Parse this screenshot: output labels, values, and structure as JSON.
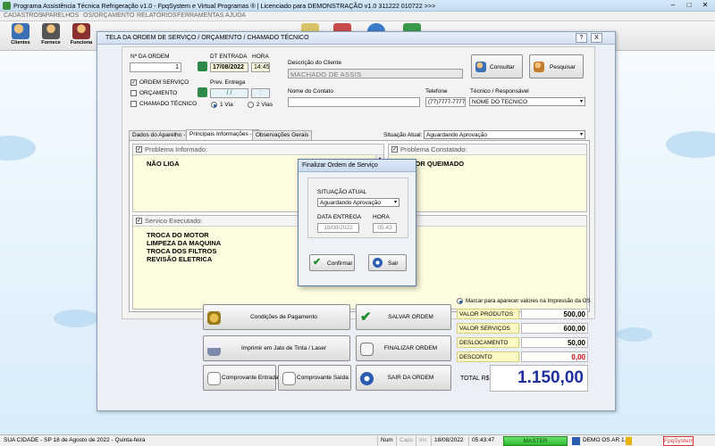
{
  "app": {
    "title": "Programa Assistência Técnica Refrigeração v1.0 - FpqSystem e Virtual Programas ® | Licenciado para  DEMONSTRAÇÃO v1.0 311222 010722 >>>"
  },
  "menu": [
    "CADASTROS",
    "APARELHOS",
    "OS/ORÇAMENTO",
    "RELATÓRIOS",
    "FERRAMENTAS",
    "AJUDA"
  ],
  "toolbar": {
    "clientes": "Clientes",
    "fornece": "Fornece",
    "funciona": "Funciona"
  },
  "window": {
    "title": "TELA DA ORDEM DE SERVIÇO / ORÇAMENTO / CHAMADO TÉCNICO",
    "help": "?",
    "close": "X"
  },
  "form": {
    "ordem_label": "Nº DA ORDEM",
    "ordem_value": "1",
    "dt_entrada_label": "DT ENTRADA",
    "dt_entrada_value": "17/08/2022",
    "hora_label": "HORA",
    "hora_value": "14:45",
    "prev_entrega_label": "Prev. Entrega",
    "prev_entrega_value": "/ /",
    "prev_hora_value": ":",
    "chk_ordem_servico": "ORDEM SERVIÇO",
    "chk_orcamento": "ORÇAMENTO",
    "chk_chamado": "CHAMADO TÉCNICO",
    "radio_1via": "1 Via",
    "radio_2vias": "2 Vias",
    "desc_cliente_label": "Descrição do Cliente",
    "desc_cliente_value": "MACHADO DE ASSIS",
    "consultar": "Consultar",
    "pesquisar": "Pesquisar",
    "contato_label": "Nome do Contato",
    "contato_value": "",
    "telefone_label": "Telefone",
    "telefone_value": "(77)7777-7777",
    "tecnico_label": "Técnico / Responsável",
    "tecnico_value": "NOME DO TECNICO"
  },
  "tabs": [
    "Dados do Aparelho ->",
    "Principais Informações ->",
    "Observações Gerais"
  ],
  "situacao": {
    "label": "Situação Atual:",
    "value": "Aguardando Aprovação"
  },
  "panels": {
    "problema_informado_title": "Problema Informado:",
    "problema_informado_text": "NÃO LIGA",
    "problema_constatado_title": "Problema Constatado:",
    "problema_constatado_text": "MOTOR QUEIMADO",
    "servico_executado_title": "Servico Executado:",
    "servico_executado_lines": [
      "TROCA DO MOTOR",
      "LIMPEZA DA MAQUINA",
      "TROCA DOS FILTROS",
      "REVISÃO ELETRICA"
    ]
  },
  "actions": {
    "condicoes": "Condições de Pagamento",
    "salvar": "SALVAR ORDEM",
    "imprimir": "Imprimir em Jato de Tinta / Laser",
    "finalizar": "FINALIZAR ORDEM",
    "comp_entrada": "Comprovante Entrada",
    "comp_saida": "Comprovante Saída",
    "sair": "SAIR DA ORDEM"
  },
  "totals": {
    "marcar_label": "Marcar para aparecer valores na Impressão da OS",
    "rows": [
      {
        "label": "VALOR PRODUTOS",
        "value": "500,00",
        "color": "#000000"
      },
      {
        "label": "VALOR SERVIÇOS",
        "value": "600,00",
        "color": "#000000"
      },
      {
        "label": "DESLOCAMENTO",
        "value": "50,00",
        "color": "#000000"
      },
      {
        "label": "DESCONTO",
        "value": "0,00",
        "color": "#cc0000"
      }
    ],
    "total_label": "TOTAL R$",
    "total_value": "1.150,00",
    "total_color": "#1f2fa0"
  },
  "dialog": {
    "title": "Finalizar Ordem de Serviço",
    "situacao_label": "SITUAÇÃO ATUAL",
    "situacao_value": "Aguardando Aprovação",
    "data_entrega_label": "DATA ENTREGA",
    "data_entrega_value": "18/08/2022",
    "hora_label": "HORA",
    "hora_value": "05:43",
    "confirmar": "Confirmar",
    "sair": "Sair"
  },
  "status": {
    "cidade": "SUA CIDADE - SP 18 de Agosto de 2022 - Quinta-feira",
    "num": "Num",
    "caps": "Caps",
    "ins": "Ins",
    "date": "18/08/2022",
    "time": "05:43:47",
    "master": "MASTER",
    "demo": "DEMO OS AR 1.0",
    "brand": "FpqSystem"
  }
}
